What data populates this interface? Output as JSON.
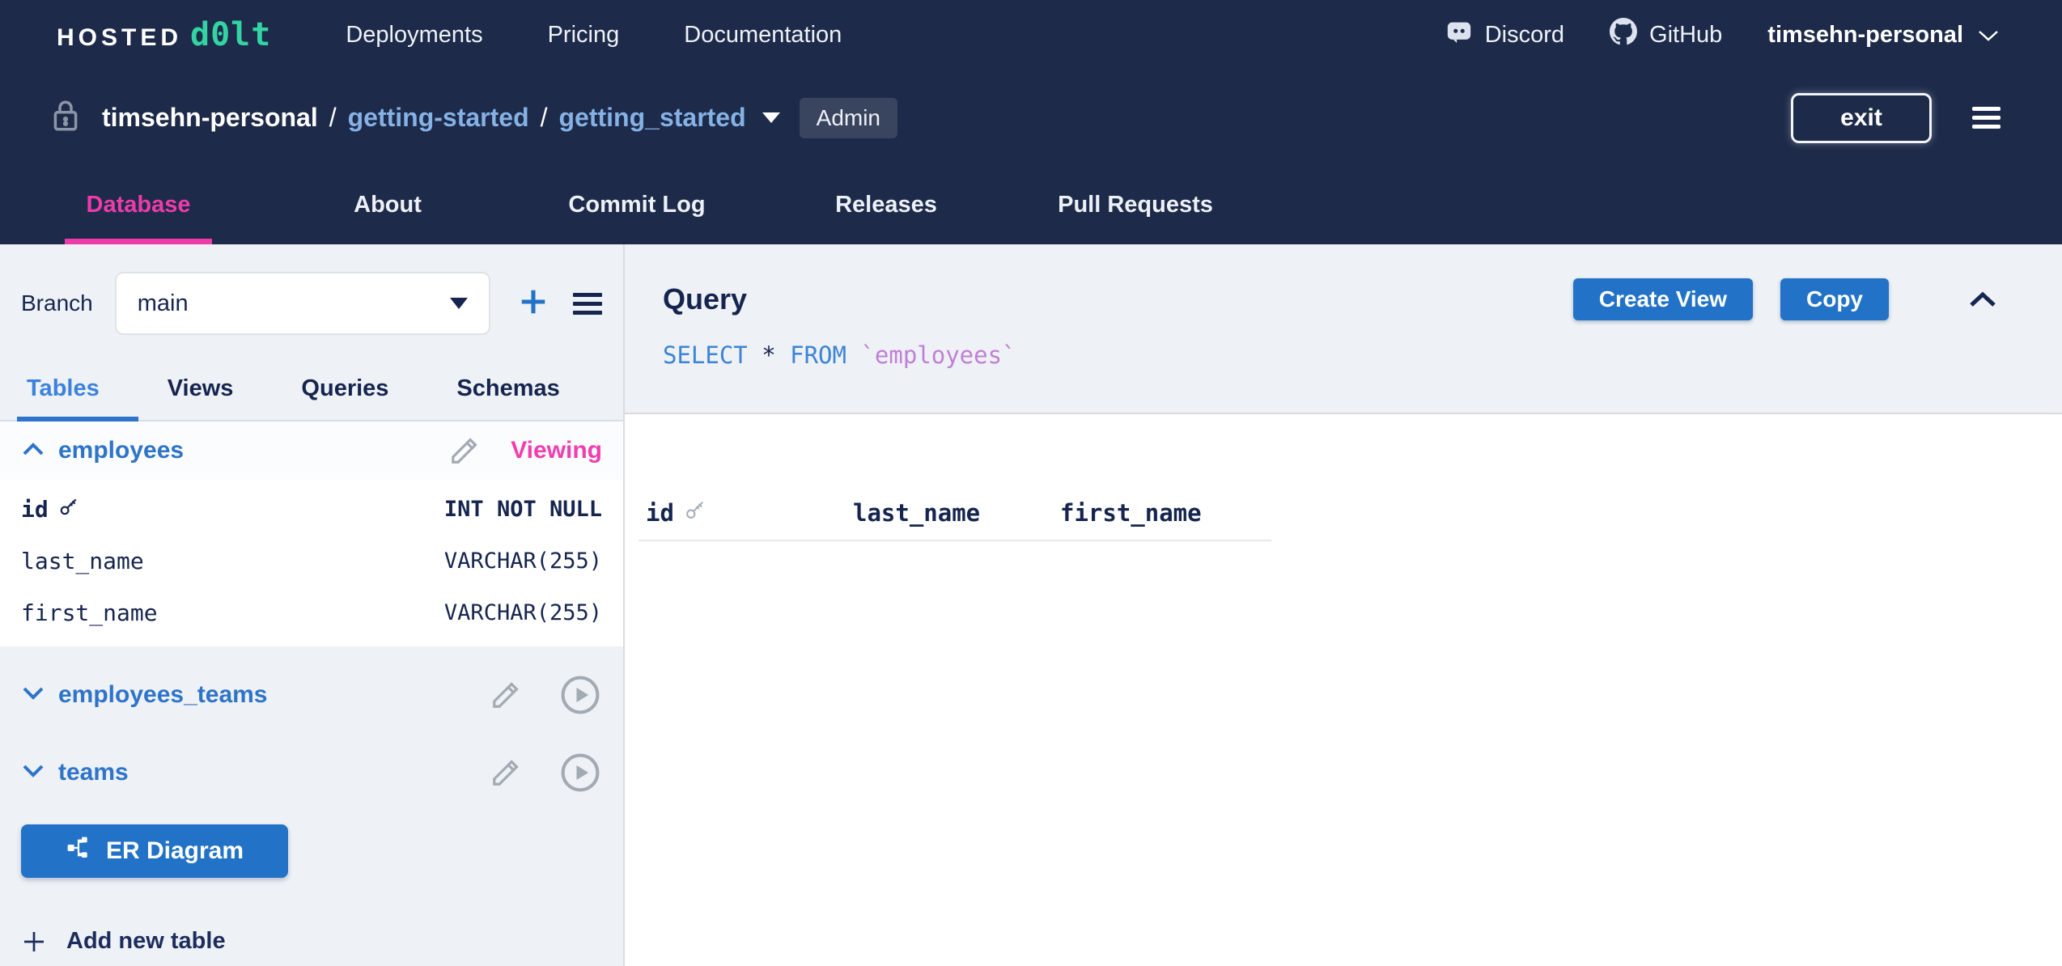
{
  "topnav": {
    "logo_hosted": "HOSTED",
    "logo_dolt": "d0lt",
    "links": [
      {
        "label": "Deployments"
      },
      {
        "label": "Pricing"
      },
      {
        "label": "Documentation"
      }
    ],
    "discord_label": "Discord",
    "github_label": "GitHub",
    "account_label": "timsehn-personal"
  },
  "breadcrumb": {
    "owner": "timsehn-personal",
    "sep1": "/",
    "repo": "getting-started",
    "sep2": "/",
    "database": "getting_started",
    "admin_badge": "Admin",
    "exit_label": "exit"
  },
  "repo_tabs": [
    {
      "label": "Database",
      "active": true
    },
    {
      "label": "About",
      "active": false
    },
    {
      "label": "Commit Log",
      "active": false
    },
    {
      "label": "Releases",
      "active": false
    },
    {
      "label": "Pull Requests",
      "active": false
    }
  ],
  "sidebar": {
    "branch_label": "Branch",
    "branch_value": "main",
    "tabs": [
      {
        "label": "Tables",
        "active": true
      },
      {
        "label": "Views",
        "active": false
      },
      {
        "label": "Queries",
        "active": false
      },
      {
        "label": "Schemas",
        "active": false
      }
    ],
    "tables": [
      {
        "name": "employees",
        "status": "Viewing",
        "expanded": true,
        "columns": [
          {
            "name": "id",
            "type": "INT NOT NULL",
            "primary_key": true
          },
          {
            "name": "last_name",
            "type": "VARCHAR(255)",
            "primary_key": false
          },
          {
            "name": "first_name",
            "type": "VARCHAR(255)",
            "primary_key": false
          }
        ]
      },
      {
        "name": "employees_teams",
        "expanded": false
      },
      {
        "name": "teams",
        "expanded": false
      }
    ],
    "er_diagram_label": "ER Diagram",
    "add_table_label": "Add new table"
  },
  "query": {
    "title": "Query",
    "create_view_label": "Create View",
    "copy_label": "Copy",
    "sql": {
      "select": "SELECT ",
      "star": "* ",
      "from": "FROM ",
      "table": "`employees`"
    }
  },
  "results": {
    "columns": [
      {
        "name": "id",
        "primary_key": true
      },
      {
        "name": "last_name",
        "primary_key": false
      },
      {
        "name": "first_name",
        "primary_key": false
      }
    ]
  },
  "icons": [
    "discord-icon",
    "github-icon",
    "chevron-down-icon",
    "lock-icon",
    "hamburger-icon",
    "branch-caret-icon",
    "plus-icon",
    "menu-icon",
    "chevron-up-icon",
    "pencil-icon",
    "play-icon",
    "key-icon",
    "er-diagram-icon",
    "collapse-icon"
  ],
  "colors": {
    "header_navy": "#1d2a49",
    "accent_pink": "#ed3ca9",
    "accent_blue": "#2273c8",
    "link_blue": "#85b1e4",
    "logo_teal": "#33d3a2",
    "text_navy": "#16254f"
  }
}
